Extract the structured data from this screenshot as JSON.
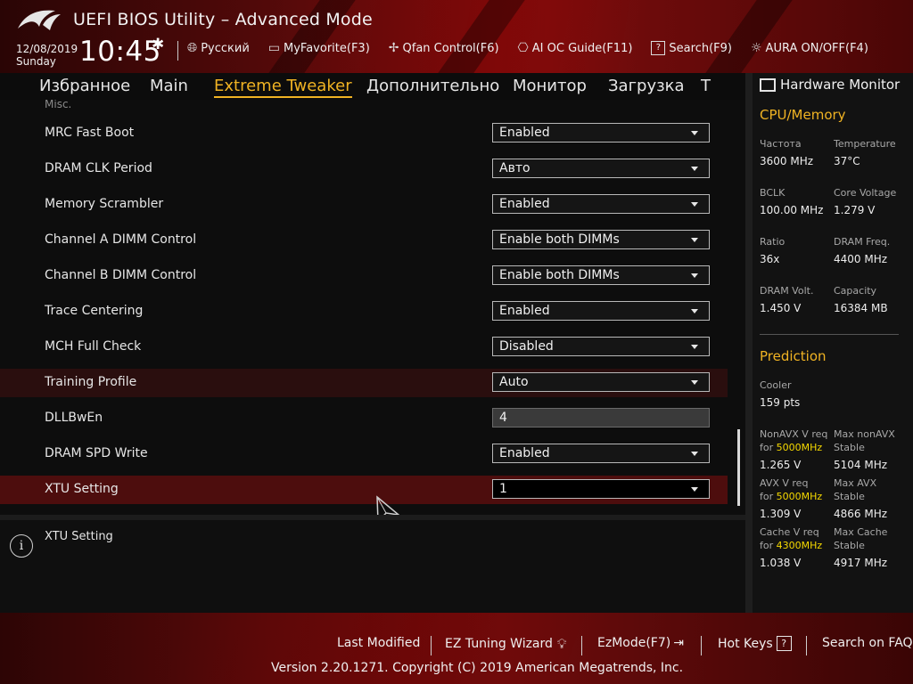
{
  "header": {
    "title": "UEFI BIOS Utility – Advanced Mode",
    "date": "12/08/2019",
    "day": "Sunday",
    "time": "10:45",
    "tools": [
      {
        "icon": "globe-icon",
        "label": "Русский"
      },
      {
        "icon": "favorite-icon",
        "label": "MyFavorite(F3)"
      },
      {
        "icon": "fan-icon",
        "label": "Qfan Control(F6)"
      },
      {
        "icon": "ai-oc-icon",
        "label": "AI OC Guide(F11)"
      },
      {
        "icon": "search-help-icon",
        "label": "Search(F9)"
      },
      {
        "icon": "aura-icon",
        "label": "AURA ON/OFF(F4)"
      }
    ]
  },
  "tabs": [
    "Избранное",
    "Main",
    "Extreme Tweaker",
    "Дополнительно",
    "Монитор",
    "Загрузка",
    "Т"
  ],
  "active_tab": "Extreme Tweaker",
  "section_label": "Misc.",
  "settings": [
    {
      "label": "MRC Fast Boot",
      "value": "Enabled"
    },
    {
      "label": "DRAM CLK Period",
      "value": "Авто"
    },
    {
      "label": "Memory Scrambler",
      "value": "Enabled"
    },
    {
      "label": "Channel A DIMM Control",
      "value": "Enable both DIMMs"
    },
    {
      "label": "Channel B DIMM Control",
      "value": "Enable both DIMMs"
    },
    {
      "label": "Trace Centering",
      "value": "Enabled"
    },
    {
      "label": "MCH Full Check",
      "value": "Disabled"
    },
    {
      "label": "Training Profile",
      "value": "Auto"
    },
    {
      "label": "DLLBwEn",
      "value": "4"
    },
    {
      "label": "DRAM SPD Write",
      "value": "Enabled"
    },
    {
      "label": "XTU Setting",
      "value": "1"
    }
  ],
  "help": {
    "text": "XTU Setting"
  },
  "hardware_monitor": {
    "title": "Hardware Monitor",
    "cpu_section": "CPU/Memory",
    "cpu": [
      {
        "label": "Частота",
        "value": "3600 MHz"
      },
      {
        "label": "Temperature",
        "value": "37°C"
      },
      {
        "label": "BCLK",
        "value": "100.00 MHz"
      },
      {
        "label": "Core Voltage",
        "value": "1.279 V"
      },
      {
        "label": "Ratio",
        "value": "36x"
      },
      {
        "label": "DRAM Freq.",
        "value": "4400 MHz"
      },
      {
        "label": "DRAM Volt.",
        "value": "1.450 V"
      },
      {
        "label": "Capacity",
        "value": "16384 MB"
      }
    ],
    "prediction_section": "Prediction",
    "cooler_label": "Cooler",
    "cooler_value": "159 pts",
    "prediction": [
      {
        "label_a": "NonAVX V req",
        "label_b": "for",
        "freq": "5000MHz",
        "value": "1.265 V",
        "max_label_a": "Max nonAVX",
        "max_label_b": "Stable",
        "max_value": "5104 MHz"
      },
      {
        "label_a": "AVX V req",
        "label_b": "for",
        "freq": "5000MHz",
        "value": "1.309 V",
        "max_label_a": "Max AVX",
        "max_label_b": "Stable",
        "max_value": "4866 MHz"
      },
      {
        "label_a": "Cache V req",
        "label_b": "for",
        "freq": "4300MHz",
        "value": "1.038 V",
        "max_label_a": "Max Cache",
        "max_label_b": "Stable",
        "max_value": "4917 MHz"
      }
    ]
  },
  "footer": {
    "last_modified": "Last Modified",
    "ez_tuning": "EZ Tuning Wizard",
    "ez_mode": "EzMode(F7)",
    "hot_keys": "Hot Keys",
    "hot_keys_box": "?",
    "search_faq": "Search on FAQ",
    "copyright": "Version 2.20.1271. Copyright (C) 2019 American Megatrends, Inc."
  },
  "colors": {
    "accent": "#f0b323",
    "highlight": "#f5d800",
    "selected_row": "#4d0d0d",
    "hover_row": "#2a0e0e"
  }
}
